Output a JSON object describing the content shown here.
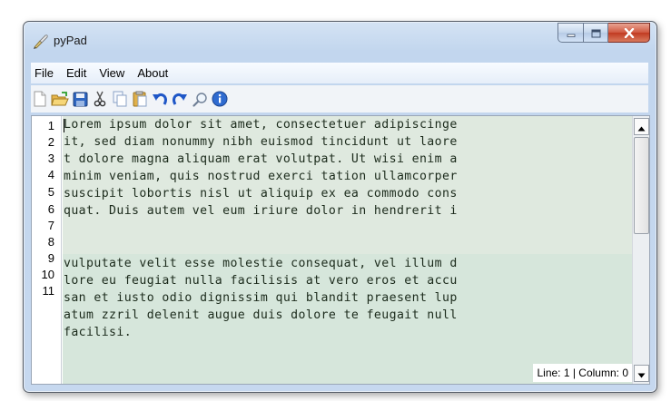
{
  "window": {
    "title": "pyPad"
  },
  "icons": {
    "app": "paint-brush-icon",
    "minimize": "minimize-icon",
    "maximize": "maximize-icon",
    "close": "close-icon"
  },
  "menu": [
    "File",
    "Edit",
    "View",
    "About"
  ],
  "toolbar": [
    {
      "name": "new-file-icon"
    },
    {
      "name": "open-folder-icon"
    },
    {
      "name": "save-icon"
    },
    {
      "name": "cut-icon"
    },
    {
      "name": "copy-icon"
    },
    {
      "name": "paste-icon"
    },
    {
      "name": "undo-icon"
    },
    {
      "name": "redo-icon"
    },
    {
      "name": "find-icon"
    },
    {
      "name": "info-icon"
    }
  ],
  "editor": {
    "line_numbers": [
      "1",
      "2",
      "3",
      "4",
      "5",
      "6",
      "7",
      "8",
      "9",
      "10",
      "11"
    ],
    "lines": [
      "Lorem ipsum dolor sit amet, consectetuer adipiscinge",
      "it, sed diam nonummy nibh euismod tincidunt ut laore",
      "t dolore magna aliquam erat volutpat. Ut wisi enim a",
      "minim veniam, quis nostrud exerci tation ullamcorper",
      "suscipit lobortis nisl ut aliquip ex ea commodo cons",
      "quat. Duis autem vel eum iriure dolor in hendrerit i",
      "",
      "vulputate velit esse molestie consequat, vel illum d",
      "lore eu feugiat nulla facilisis at vero eros et accu",
      "san et iusto odio dignissim qui blandit praesent lup",
      "atum zzril delenit augue duis dolore te feugait null",
      "facilisi."
    ]
  },
  "status": {
    "text": "Line: 1 | Column: 0"
  },
  "colors": {
    "title_bar": "#c6d8ef",
    "text_highlight": "#dfe9df",
    "close_button": "#c13a21"
  }
}
